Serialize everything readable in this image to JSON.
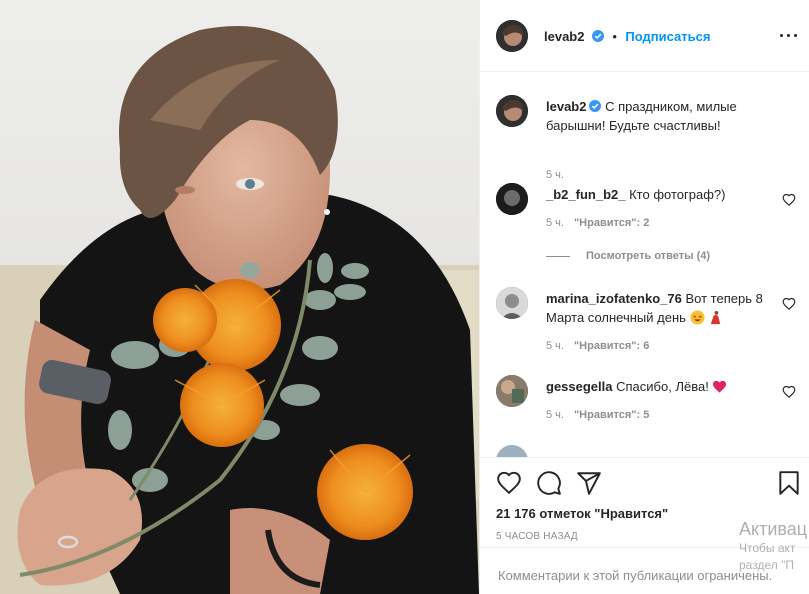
{
  "post": {
    "author": "levab2",
    "follow_label": "Подписаться",
    "dot": "•",
    "caption": "С праздником, милые барышни! Будьте счастливы!",
    "caption_time": "5 ч."
  },
  "comments": [
    {
      "user": "_b2_fun_b2_",
      "text": "Кто фотограф?)",
      "time": "5 ч.",
      "likes": "\"Нравится\": 2"
    },
    {
      "user": "marina_izofatenko_76",
      "text": "Вот теперь 8 Марта солнечный день",
      "time": "5 ч.",
      "likes": "\"Нравится\": 6"
    },
    {
      "user": "gessegella",
      "text": "Спасибо, Лёва!",
      "time": "5 ч.",
      "likes": "\"Нравится\": 5"
    }
  ],
  "view_replies": "Посмотреть ответы (4)",
  "actions": {
    "icons": [
      "heart-icon",
      "comment-icon",
      "share-icon",
      "bookmark-icon"
    ],
    "likes_text": "21 176 отметок \"Нравится\"",
    "time_ago": "5 ЧАСОВ НАЗАД"
  },
  "comments_closed": "Комментарии к этой публикации ограничены.",
  "watermark": {
    "line1": "Активац",
    "line2": "Чтобы акт",
    "line3": "раздел \"П"
  },
  "colors": {
    "accent": "#0095f6",
    "verified": "#3897f0",
    "text": "#262626",
    "muted": "#8e8e8e",
    "border": "#efefef"
  }
}
